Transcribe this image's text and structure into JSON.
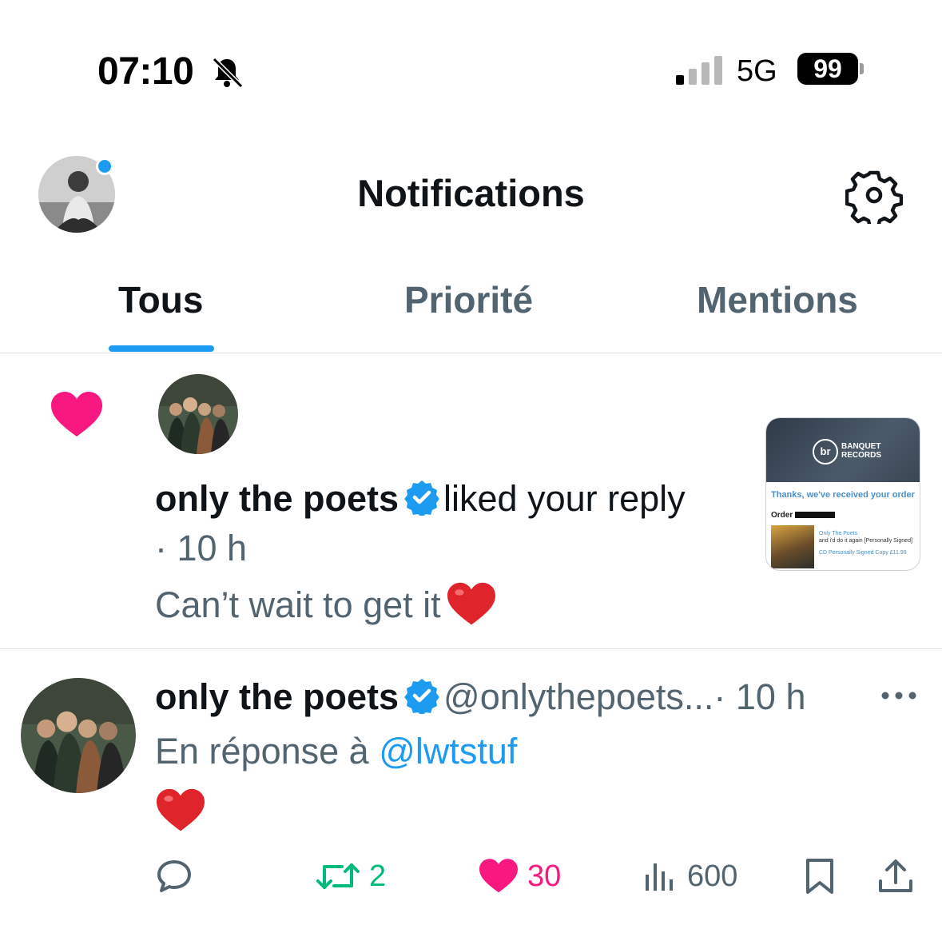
{
  "status_bar": {
    "time": "07:10",
    "network": "5G",
    "battery": "99"
  },
  "header": {
    "title": "Notifications"
  },
  "tabs": [
    {
      "label": "Tous",
      "active": true
    },
    {
      "label": "Priorité",
      "active": false
    },
    {
      "label": "Mentions",
      "active": false
    }
  ],
  "notification_like": {
    "user": "only the poets",
    "action": "liked your reply",
    "time": "· 10 h",
    "reply_text": "Can’t wait to get it",
    "thumbnail": {
      "logo": "br",
      "brand": "BANQUET RECORDS",
      "message": "Thanks, we've received your order",
      "order_label": "Order",
      "product_artist": "Only The Poets",
      "product_title": "and i'd do it again [Personally Signed]",
      "product_variant": "CD Personally Signed Copy £11.99"
    }
  },
  "reply_tweet": {
    "user": "only the poets",
    "handle": "@onlythepoets...",
    "time": "· 10 h",
    "in_reply_label": "En réponse à",
    "mention": "@lwtstuf",
    "actions": {
      "retweets": "2",
      "likes": "30",
      "views": "600"
    }
  },
  "colors": {
    "accent": "#1d9bf0",
    "like": "#f91880",
    "retweet": "#00ba7c",
    "secondary_text": "#536471"
  }
}
